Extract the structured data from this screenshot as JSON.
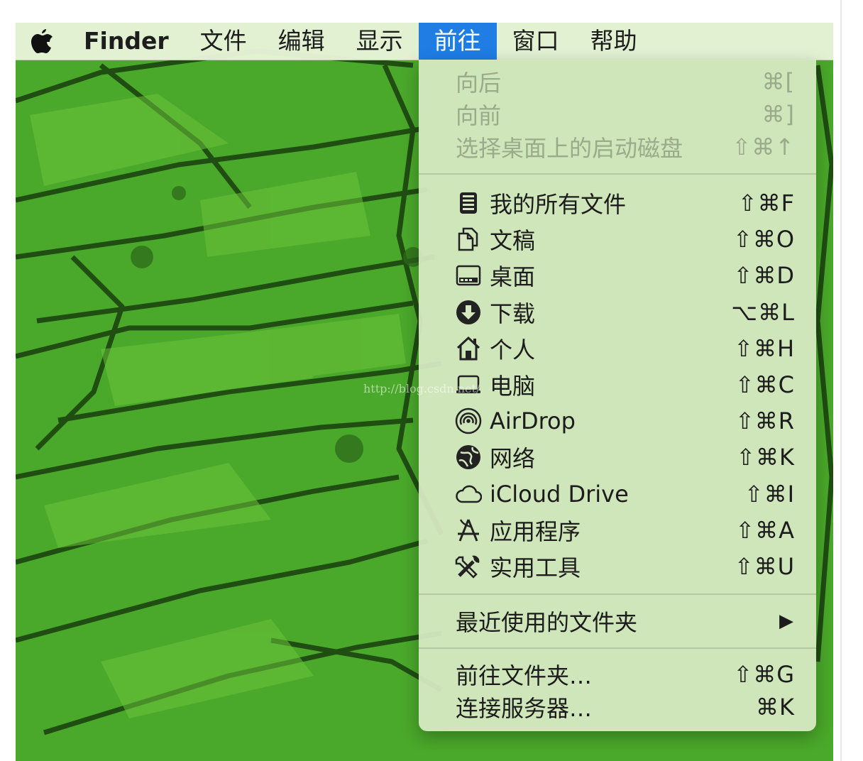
{
  "menubar": {
    "apple_icon": "apple-logo-icon",
    "items": [
      "Finder",
      "文件",
      "编辑",
      "显示",
      "前往",
      "窗口",
      "帮助"
    ],
    "active_item": "前往",
    "active_color": "#1f7de3"
  },
  "go_menu": {
    "history": [
      {
        "label": "向后",
        "shortcut": "⌘[",
        "enabled": false
      },
      {
        "label": "向前",
        "shortcut": "⌘]",
        "enabled": false
      },
      {
        "label": "选择桌面上的启动磁盘",
        "shortcut": "⇧⌘↑",
        "enabled": false
      }
    ],
    "places": [
      {
        "label": "我的所有文件",
        "shortcut": "⇧⌘F",
        "icon": "all-my-files-icon"
      },
      {
        "label": "文稿",
        "shortcut": "⇧⌘O",
        "icon": "documents-icon"
      },
      {
        "label": "桌面",
        "shortcut": "⇧⌘D",
        "icon": "desktop-icon"
      },
      {
        "label": "下载",
        "shortcut": "⌥⌘L",
        "icon": "downloads-icon"
      },
      {
        "label": "个人",
        "shortcut": "⇧⌘H",
        "icon": "home-icon"
      },
      {
        "label": "电脑",
        "shortcut": "⇧⌘C",
        "icon": "computer-icon"
      },
      {
        "label": "AirDrop",
        "shortcut": "⇧⌘R",
        "icon": "airdrop-icon"
      },
      {
        "label": "网络",
        "shortcut": "⇧⌘K",
        "icon": "network-icon"
      },
      {
        "label": "iCloud Drive",
        "shortcut": "⇧⌘I",
        "icon": "icloud-icon"
      },
      {
        "label": "应用程序",
        "shortcut": "⇧⌘A",
        "icon": "applications-icon"
      },
      {
        "label": "实用工具",
        "shortcut": "⇧⌘U",
        "icon": "utilities-icon"
      }
    ],
    "recent_folders": {
      "label": "最近使用的文件夹",
      "submenu_arrow": "▶"
    },
    "actions": [
      {
        "label": "前往文件夹…",
        "shortcut": "⇧⌘G"
      },
      {
        "label": "连接服务器…",
        "shortcut": "⌘K"
      }
    ]
  },
  "watermark": "http://blog.csdn.net/"
}
